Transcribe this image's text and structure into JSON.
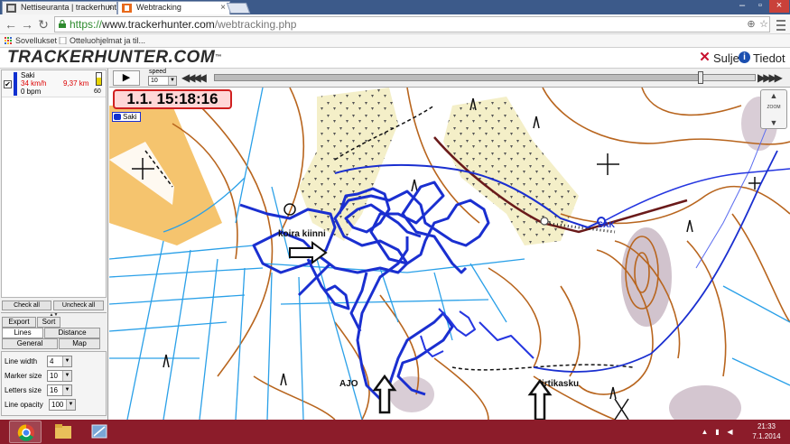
{
  "browser": {
    "tabs": [
      {
        "title": "Nettiseuranta | trackerhunt"
      },
      {
        "title": "Webtracking"
      }
    ],
    "url": {
      "scheme": "https://",
      "host": "www.trackerhunter.com",
      "path": "/webtracking.php"
    },
    "bookmarks": [
      {
        "label": "Sovellukset"
      },
      {
        "label": "Otteluohjelmat ja til..."
      }
    ]
  },
  "site": {
    "logo": "TRACKERHUNTER.COM",
    "logo_tm": "™",
    "close_label": "Sulje",
    "info_label": "Tiedot"
  },
  "trackers": [
    {
      "name": "Saki",
      "speed": "34 km/h",
      "distance": "9,37 km",
      "heart_rate": "0 bpm",
      "battery": "60",
      "battery_level": 0.6,
      "color": "#1030d0",
      "checked": true
    }
  ],
  "sidebar": {
    "check_all": "Check all",
    "uncheck_all": "Uncheck all",
    "tabs_row1": [
      "Export",
      "Sort"
    ],
    "tabs_row2": [
      "Lines",
      "Distance"
    ],
    "tabs_row3": [
      "General",
      "Map"
    ],
    "settings": [
      {
        "label": "Line width",
        "value": "4"
      },
      {
        "label": "Marker size",
        "value": "10"
      },
      {
        "label": "Letters size",
        "value": "16"
      },
      {
        "label": "Line opacity",
        "value": "100"
      }
    ]
  },
  "playback": {
    "play_icon": "▶",
    "speed_label": "speed",
    "speed_value": "10",
    "rewind_icon": "◀◀◀◀",
    "forward_icon": "▶▶▶▶",
    "position": 0.9
  },
  "map": {
    "time": "1.1. 15:18:16",
    "legend_name": "Saki",
    "zoom_label": "ZOOM",
    "labels": {
      "koira": "koira kiinni",
      "ajo": "AJO",
      "irtikasku": "irtikasku",
      "sak": "SAK"
    }
  },
  "taskbar": {
    "time": "21:33",
    "date": "7.1.2014"
  },
  "colors": {
    "track": "#1030d0",
    "contour": "#b8651e",
    "water": "#2aa0e8",
    "field": "#f5c46e",
    "taskbar": "#8c1c2a",
    "time_box": "#d02020"
  }
}
